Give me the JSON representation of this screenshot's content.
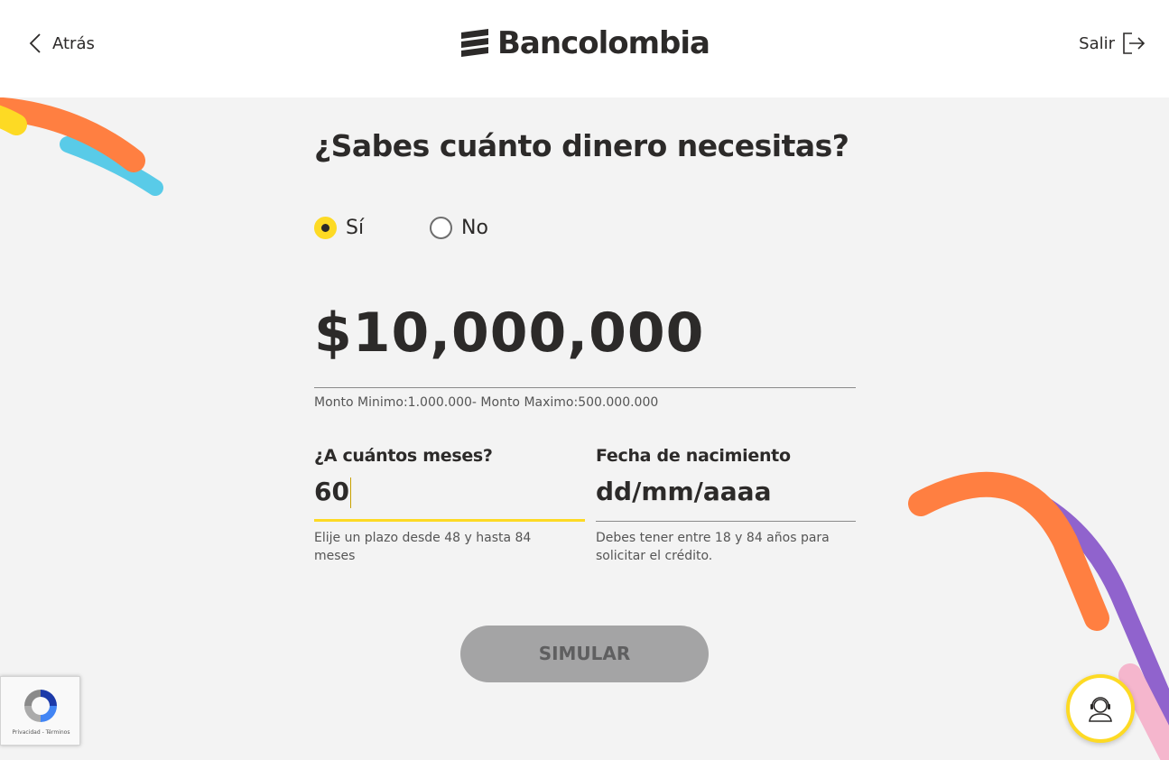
{
  "header": {
    "back_label": "Atrás",
    "logo_text": "Bancolombia",
    "exit_label": "Salir"
  },
  "form": {
    "question": "¿Sabes cuánto dinero necesitas?",
    "radio_yes": "Sí",
    "radio_no": "No",
    "selected_option": "Sí",
    "amount_value": "$10,000,000",
    "amount_hint": "Monto Minimo:1.000.000- Monto Maximo:500.000.000",
    "months_label": "¿A cuántos meses?",
    "months_value": "60",
    "months_help": "Elije un plazo desde 48 y hasta 84 meses",
    "birth_label": "Fecha de nacimiento",
    "birth_placeholder": "dd/mm/aaaa",
    "birth_help": "Debes tener entre 18 y 84 años para solicitar el crédito.",
    "submit_label": "SIMULAR"
  },
  "recaptcha": {
    "links": "Privacidad - Términos"
  },
  "colors": {
    "brand_yellow": "#fdda24",
    "button_disabled": "#a4a4a5",
    "deco_orange": "#ff7f41",
    "deco_blue": "#59cbe8",
    "deco_purple": "#9063cd",
    "deco_pink": "#f5b6cd"
  },
  "icons": {
    "back": "chevron-left-icon",
    "exit": "logout-icon",
    "help": "agent-headset-icon",
    "recaptcha": "recaptcha-icon"
  }
}
